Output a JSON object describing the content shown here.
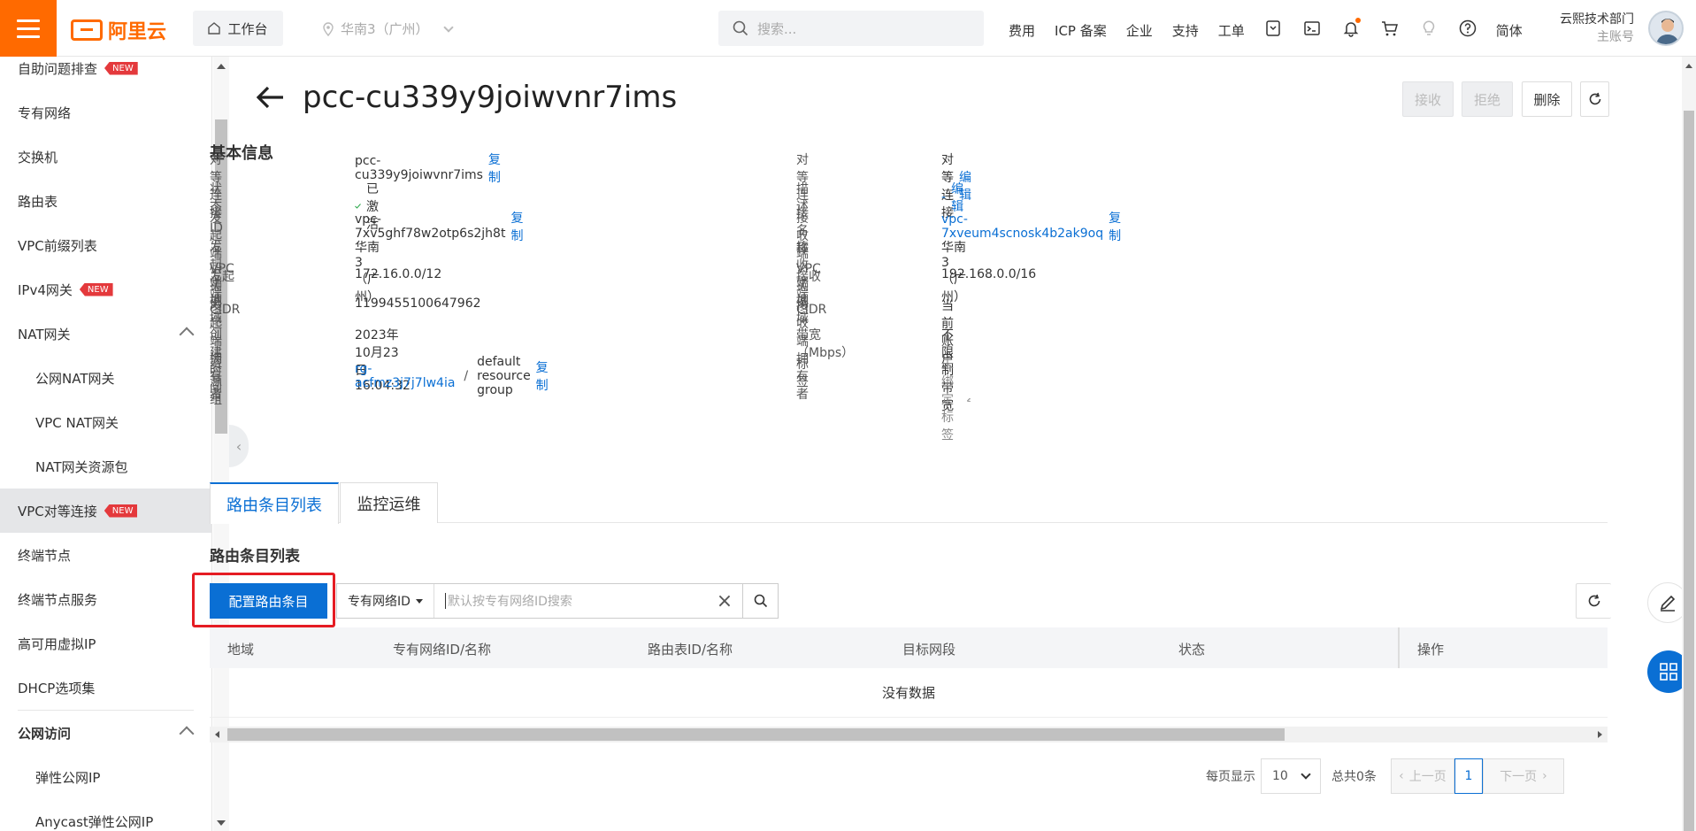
{
  "topbar": {
    "logo_text": "阿里云",
    "workbench": "工作台",
    "region": "华南3（广州）",
    "search_placeholder": "搜索...",
    "nav": [
      "费用",
      "ICP 备案",
      "企业",
      "支持",
      "工单"
    ],
    "lang": "简体",
    "account_name": "云熙技术部门",
    "account_type": "主账号"
  },
  "sidebar": {
    "items": [
      {
        "label": "自助问题排查",
        "badge": "NEW"
      },
      {
        "label": "专有网络"
      },
      {
        "label": "交换机"
      },
      {
        "label": "路由表"
      },
      {
        "label": "VPC前缀列表"
      },
      {
        "label": "IPv4网关",
        "badge": "NEW"
      },
      {
        "label": "NAT网关"
      },
      {
        "label": "公网NAT网关"
      },
      {
        "label": "VPC NAT网关"
      },
      {
        "label": "NAT网关资源包"
      },
      {
        "label": "VPC对等连接",
        "badge": "NEW"
      },
      {
        "label": "终端节点"
      },
      {
        "label": "终端节点服务"
      },
      {
        "label": "高可用虚拟IP"
      },
      {
        "label": "DHCP选项集"
      },
      {
        "label": "公网访问"
      },
      {
        "label": "弹性公网IP"
      },
      {
        "label": "Anycast弹性公网IP"
      }
    ]
  },
  "page": {
    "title": "pcc-cu339y9joiwvnr7ims",
    "btn_accept": "接收",
    "btn_reject": "拒绝",
    "btn_delete": "删除"
  },
  "basic": {
    "heading": "基本信息",
    "copy": "复制",
    "edit": "编辑",
    "left": [
      {
        "label": "对等连接ID",
        "value": "pcc-cu339y9joiwvnr7ims"
      },
      {
        "label": "状态",
        "value": "已激活"
      },
      {
        "label": "发起端VPC实例",
        "value": "vpc-7xv5ghf78w2otp6s2jh8t"
      },
      {
        "label": "发起端地域",
        "value": "华南3（广州）"
      },
      {
        "label": "发起端CIDR",
        "value": "172.16.0.0/12"
      },
      {
        "label": "发起端拥有者",
        "value": "1199455100647962"
      },
      {
        "label": "创建时间",
        "value": "2023年10月23日 16:04:32"
      },
      {
        "label": "资源组",
        "value": "rg-acfmz3j7j7lw4ia",
        "extra": "default resource group"
      }
    ],
    "right": [
      {
        "label": "对等连接名称",
        "value": "对等连接"
      },
      {
        "label": "描述",
        "value": "-"
      },
      {
        "label": "接收端VPC实例",
        "value": "vpc-7xveum4scnosk4b2ak9oq"
      },
      {
        "label": "接收端地域",
        "value": "华南3（广州）"
      },
      {
        "label": "接收端CIDR",
        "value": "192.168.0.0/16"
      },
      {
        "label": "接收端拥有者",
        "value": "当前账户"
      },
      {
        "label": "带宽（Mbps）",
        "value": "不限制带宽"
      },
      {
        "label": "标签",
        "value": "未绑定标签"
      }
    ]
  },
  "tabs": [
    "路由条目列表",
    "监控运维"
  ],
  "routes": {
    "heading": "路由条目列表",
    "config_button": "配置路由条目",
    "filter_select": "专有网络ID",
    "filter_placeholder": "默认按专有网络ID搜索",
    "columns": [
      "地域",
      "专有网络ID/名称",
      "路由表ID/名称",
      "目标网段",
      "状态",
      "操作"
    ],
    "empty_text": "没有数据"
  },
  "pagination": {
    "per_page_label": "每页显示",
    "per_page": "10",
    "total": "总共0条",
    "prev": "上一页",
    "current": "1",
    "next": "下一页"
  },
  "colors": {
    "brand": "#ff6a00",
    "primary": "#0a6fd4",
    "badge": "#e4393c",
    "highlight": "#e51c23",
    "success": "#2ba84a"
  }
}
